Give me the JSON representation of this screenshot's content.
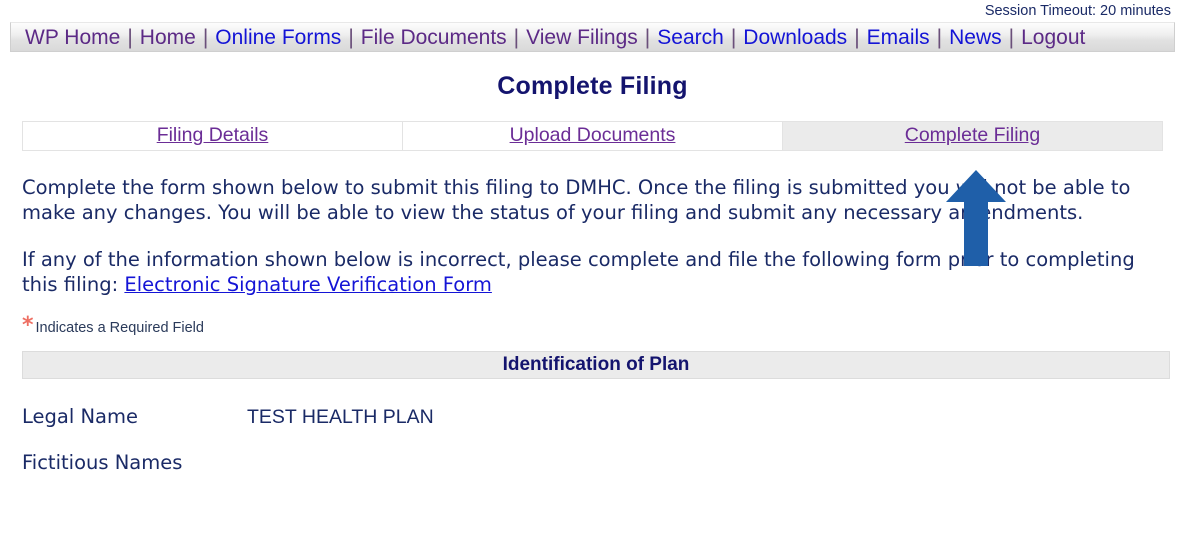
{
  "session": {
    "timeout_text": "Session Timeout: 20 minutes"
  },
  "nav": {
    "separator": "|",
    "items": [
      {
        "label": "WP Home",
        "state": "visited"
      },
      {
        "label": "Home",
        "state": "visited"
      },
      {
        "label": "Online Forms",
        "state": "unvisited"
      },
      {
        "label": "File Documents",
        "state": "visited"
      },
      {
        "label": "View Filings",
        "state": "visited"
      },
      {
        "label": "Search",
        "state": "unvisited"
      },
      {
        "label": "Downloads",
        "state": "unvisited"
      },
      {
        "label": "Emails",
        "state": "unvisited"
      },
      {
        "label": "News",
        "state": "unvisited"
      },
      {
        "label": "Logout",
        "state": "visited"
      }
    ]
  },
  "header": {
    "title": "Complete Filing"
  },
  "tabs": [
    {
      "label": "Filing Details",
      "active": false
    },
    {
      "label": "Upload Documents",
      "active": false
    },
    {
      "label": "Complete Filing",
      "active": true
    }
  ],
  "main": {
    "paragraph_1": "Complete the form shown below to submit this filing to DMHC. Once the filing is submitted you will not be able to make any changes. You will be able to view the status of your filing and submit any necessary amendments.",
    "paragraph_2_prefix": "If any of the information shown below is incorrect, please complete and file the following form prior to completing this filing: ",
    "paragraph_2_link": "Electronic Signature Verification Form",
    "required_marker": "*",
    "required_note": "Indicates a Required Field",
    "section_title": "Identification of Plan",
    "fields": [
      {
        "label": "Legal Name",
        "value": "TEST HEALTH PLAN"
      },
      {
        "label": "Fictitious Names",
        "value": ""
      }
    ]
  },
  "annotation": {
    "arrow_direction": "up",
    "arrow_color": "#1f5fa9"
  },
  "colors": {
    "link_visited": "#5c2a86",
    "link_unvisited": "#1414d6",
    "title_navy": "#14146e",
    "body_navy": "#1a2a66",
    "asterisk_red": "#ee6f63",
    "banner_grey": "#ebebeb",
    "nav_grey": "#e2e2e2"
  }
}
